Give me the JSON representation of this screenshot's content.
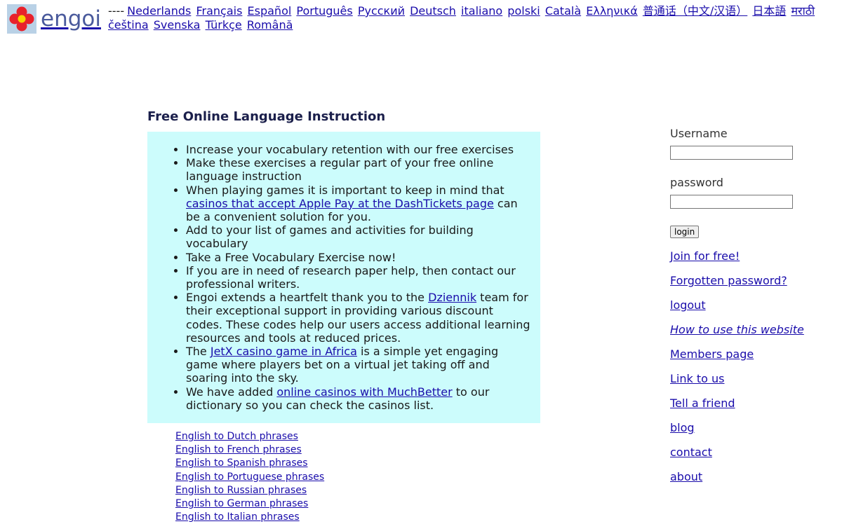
{
  "header": {
    "logo_text": "engoi",
    "dashes": "----",
    "languages": [
      "Nederlands",
      "Français",
      "Español",
      "Português",
      "Русский",
      "Deutsch",
      "italiano",
      "polski",
      "Català",
      "Ελληνικά",
      "普通话（中文/汉语）",
      "日本語",
      "मराठी",
      "čeština",
      "Svenska",
      "Türkçe",
      "Română"
    ]
  },
  "main": {
    "title": "Free Online Language Instruction",
    "bullets": [
      {
        "text": "Increase your vocabulary retention with our free exercises"
      },
      {
        "text": "Make these exercises a regular part of your free online language instruction"
      },
      {
        "pre": "When playing games it is important to keep in mind that ",
        "link": "casinos that accept Apple Pay at the DashTickets page",
        "post": " can be a convenient solution for you."
      },
      {
        "text": "Add to your list of games and activities for building vocabulary"
      },
      {
        "text": "Take a Free Vocabulary Exercise now!"
      },
      {
        "text": "If you are in need of research paper help, then contact our professional writers."
      },
      {
        "pre": "Engoi extends a heartfelt thank you to the ",
        "link": "Dziennik",
        "post": " team for their exceptional support in providing various discount codes. These codes help our users access additional learning resources and tools at reduced prices."
      },
      {
        "pre": "The ",
        "link": "JetX casino game in Africa",
        "post": " is a simple yet engaging game where players bet on a virtual jet taking off and soaring into the sky."
      },
      {
        "pre": "We have added ",
        "link": "online casinos with MuchBetter",
        "post": " to our dictionary so you can check the casinos list."
      }
    ],
    "phrase_links": [
      "English to Dutch phrases",
      "English to French phrases",
      "English to Spanish phrases",
      "English to Portuguese phrases",
      "English to Russian phrases",
      "English to German phrases",
      "English to Italian phrases"
    ]
  },
  "sidebar": {
    "username_label": "Username",
    "password_label": "password",
    "login_label": "login",
    "links": [
      {
        "text": "Join for free!",
        "italic": false
      },
      {
        "text": "Forgotten password?",
        "italic": false
      },
      {
        "text": "logout",
        "italic": false
      },
      {
        "text": "How to use this website",
        "italic": true
      },
      {
        "text": "Members page",
        "italic": false
      },
      {
        "text": "Link to us",
        "italic": false
      },
      {
        "text": "Tell a friend",
        "italic": false
      },
      {
        "text": "blog",
        "italic": false
      },
      {
        "text": "contact",
        "italic": false
      },
      {
        "text": "about",
        "italic": false
      }
    ]
  },
  "colors": {
    "logo_bg": "#b9d1e6",
    "flower_petal": "#e8212b",
    "flower_center": "#f7d300",
    "info_box_bg": "#ccfcfc",
    "link": "#1a0dab",
    "title": "#1b1f4b"
  }
}
